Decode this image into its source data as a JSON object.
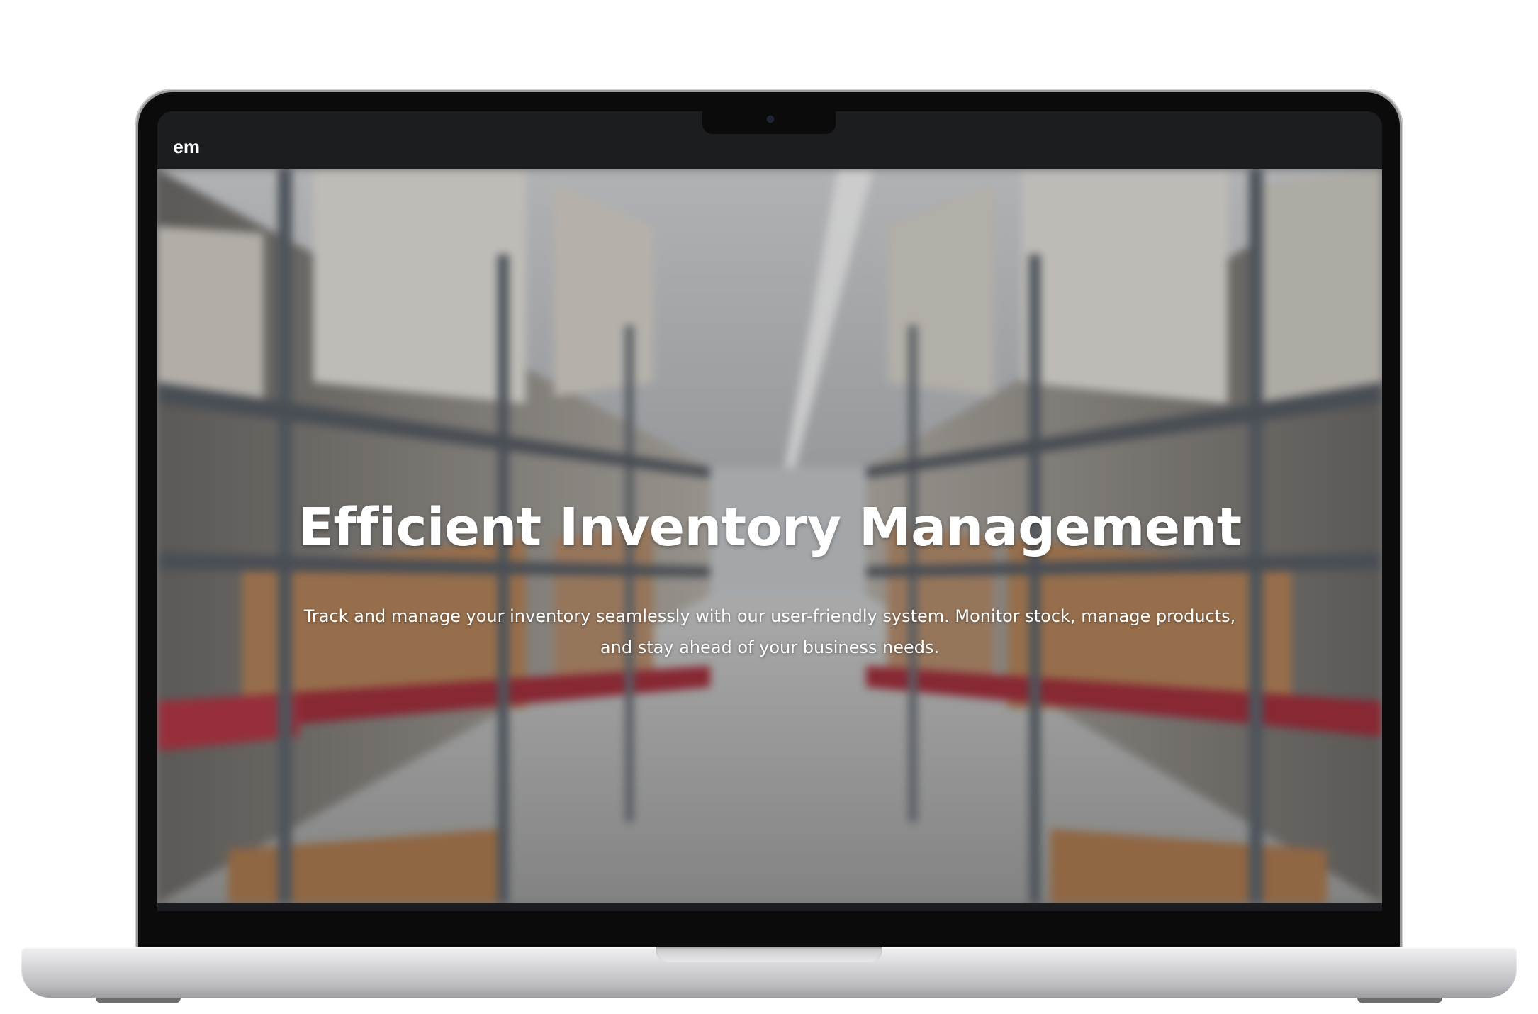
{
  "header": {
    "brand_visible": "em"
  },
  "hero": {
    "title": "Efficient Inventory Management",
    "description_line1": "Track and manage your inventory seamlessly with our user-friendly system. Monitor stock, manage products,",
    "description_line2": "and stay ahead of your business needs."
  },
  "colors": {
    "header_bg": "#1c1d21",
    "hero_text": "#ffffff",
    "bezel": "#0b0b0c"
  }
}
